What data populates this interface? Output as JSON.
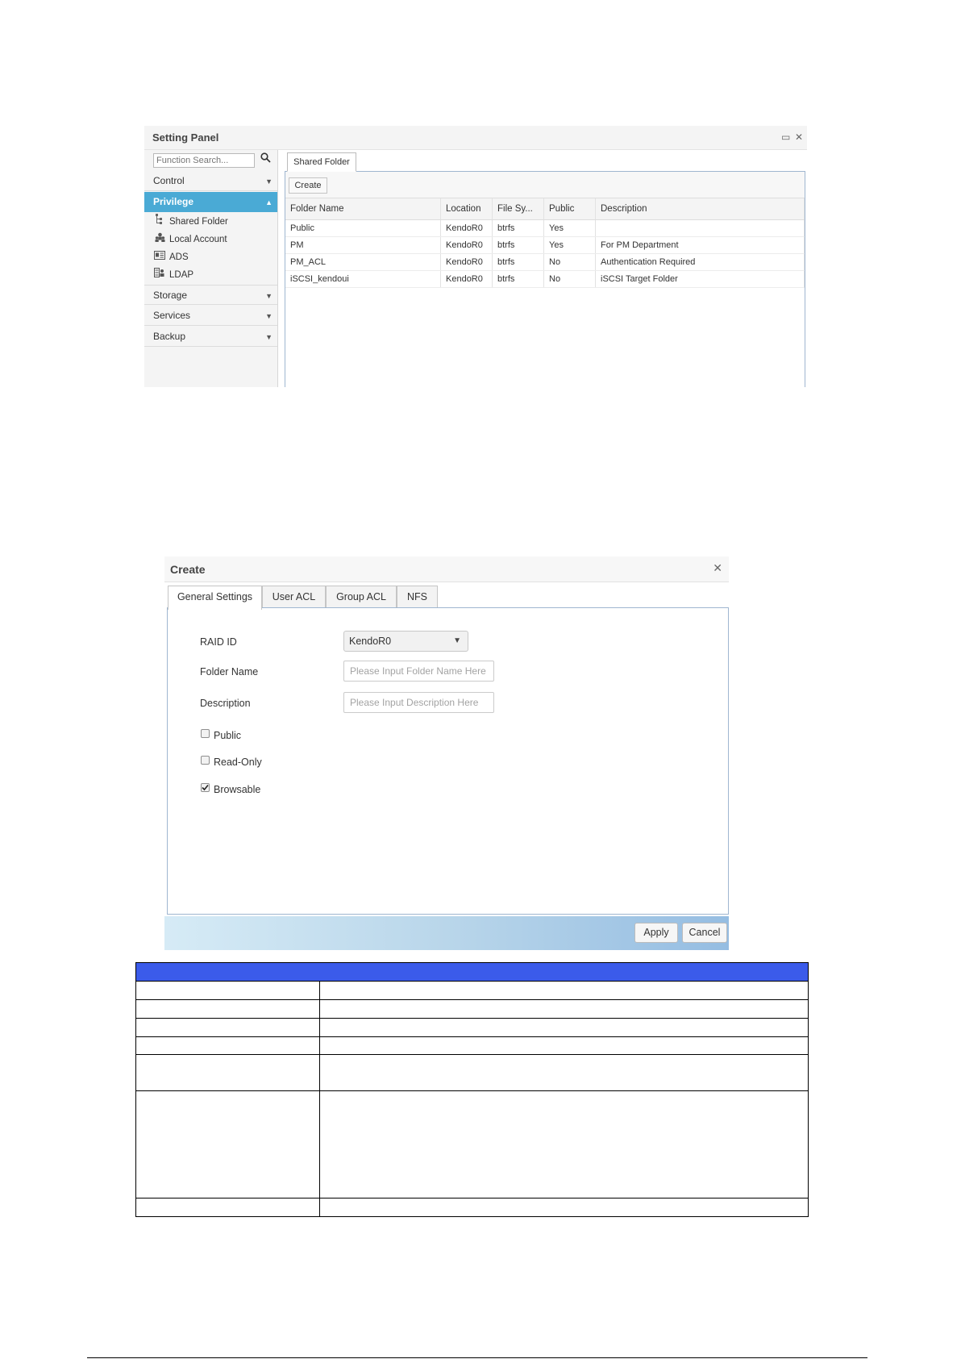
{
  "setting_panel": {
    "title": "Setting Panel",
    "restore_glyph": "▭",
    "close_glyph": "✕",
    "search_placeholder": "Function Search...",
    "categories": [
      {
        "label": "Control"
      },
      {
        "label": "Privilege"
      },
      {
        "label": "Storage"
      },
      {
        "label": "Services"
      },
      {
        "label": "Backup"
      }
    ],
    "privilege_items": [
      {
        "label": "Shared Folder",
        "icon": "tree-icon"
      },
      {
        "label": "Local Account",
        "icon": "users-icon"
      },
      {
        "label": "ADS",
        "icon": "id-card-icon"
      },
      {
        "label": "LDAP",
        "icon": "directory-icon"
      }
    ],
    "tab_label": "Shared Folder",
    "create_label": "Create",
    "columns": [
      "Folder Name",
      "Location",
      "File Sy...",
      "Public",
      "Description"
    ],
    "rows": [
      [
        "Public",
        "KendoR0",
        "btrfs",
        "Yes",
        ""
      ],
      [
        "PM",
        "KendoR0",
        "btrfs",
        "Yes",
        "For PM Department"
      ],
      [
        "PM_ACL",
        "KendoR0",
        "btrfs",
        "No",
        "Authentication Required"
      ],
      [
        "iSCSI_kendoui",
        "KendoR0",
        "btrfs",
        "No",
        "iSCSI Target Folder"
      ]
    ],
    "colors": {
      "accent": "#4aaad5"
    }
  },
  "create_dialog": {
    "title": "Create",
    "close_glyph": "✕",
    "tabs": [
      "General Settings",
      "User ACL",
      "Group ACL",
      "NFS"
    ],
    "raid_label": "RAID ID",
    "raid_value": "KendoR0",
    "folder_label": "Folder Name",
    "folder_placeholder": "Please Input Folder Name Here",
    "desc_label": "Description",
    "desc_placeholder": "Please Input Description Here",
    "checkboxes": [
      {
        "label": "Public",
        "checked": false
      },
      {
        "label": "Read-Only",
        "checked": false
      },
      {
        "label": "Browsable",
        "checked": true
      }
    ],
    "apply_label": "Apply",
    "cancel_label": "Cancel"
  },
  "doc_table": {
    "header_color": "#3b5bea"
  }
}
